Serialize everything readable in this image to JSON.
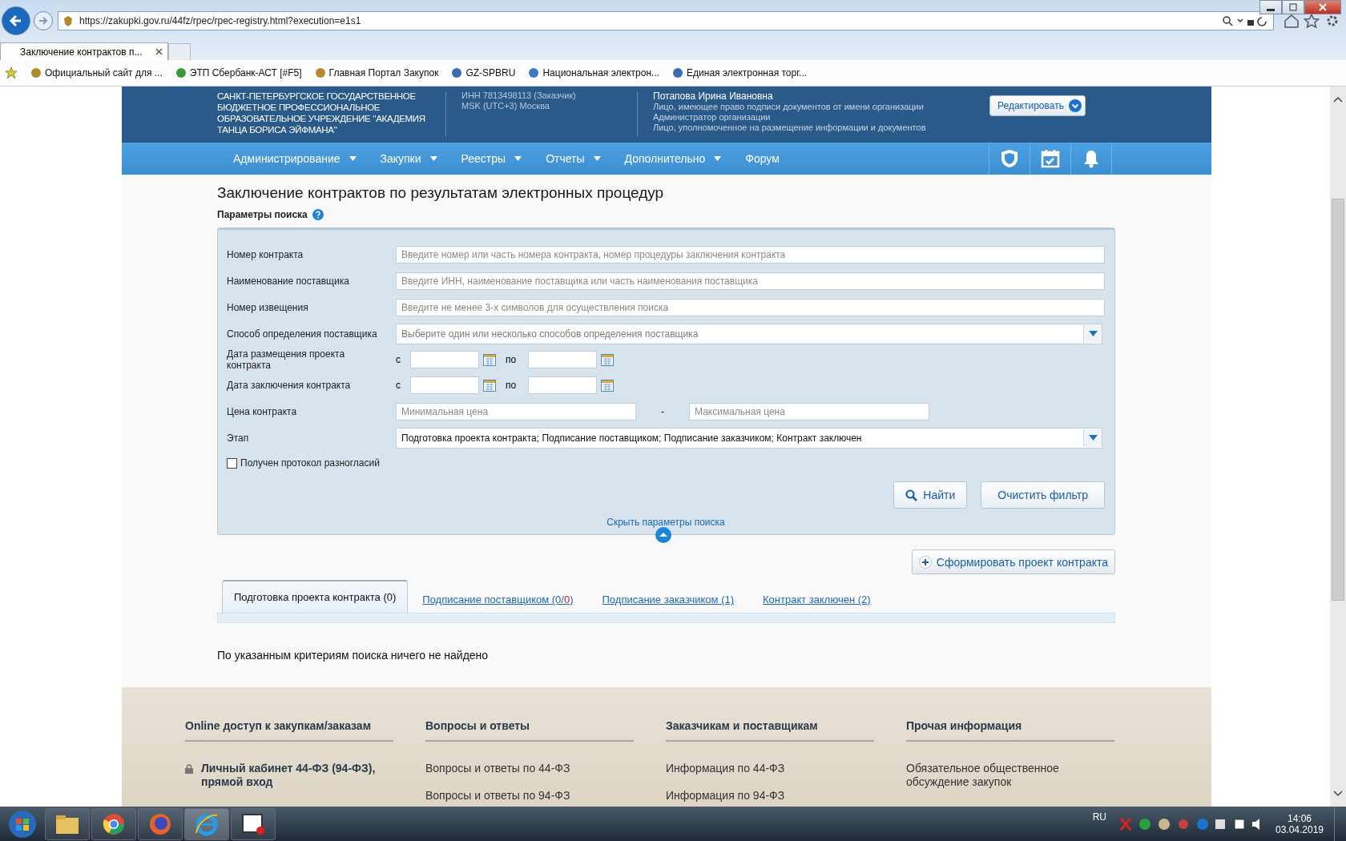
{
  "browser": {
    "url": "https://zakupki.gov.ru/44fz/rpec/rpec-registry.html?execution=e1s1",
    "tabs": [
      {
        "label": "Заключение контрактов п...",
        "selected": true
      }
    ],
    "favorites": [
      "Официальный сайт для ...",
      "ЭТП Сбербанк-АСТ [#F5]",
      "Главная Портал Закупок",
      "GZ-SPBRU",
      "Национальная электрон...",
      "Единая электронная торг..."
    ]
  },
  "header": {
    "org_name": "САНКТ-ПЕТЕРБУРГСКОЕ ГОСУДАРСТВЕННОЕ БЮДЖЕТНОЕ ПРОФЕССИОНАЛЬНОЕ ОБРАЗОВАТЕЛЬНОЕ УЧРЕЖДЕНИЕ \"АКАДЕМИЯ ТАНЦА БОРИСА ЭЙФМАНА\"",
    "inn": "ИНН 7813498113 (Заказчик)",
    "timezone": "MSK (UTC+3) Москва",
    "user_name": "Потапова Ирина Ивановна",
    "user_roles": [
      "Лицо, имеющее право подписи документов от имени организации",
      "Администратор организации",
      "Лицо, уполномоченное на размещение информации и документов"
    ],
    "edit_button": "Редактировать"
  },
  "nav": [
    {
      "label": "Администрирование",
      "dropdown": true
    },
    {
      "label": "Закупки",
      "dropdown": true
    },
    {
      "label": "Реестры",
      "dropdown": true
    },
    {
      "label": "Отчеты",
      "dropdown": true
    },
    {
      "label": "Дополнительно",
      "dropdown": true
    },
    {
      "label": "Форум",
      "dropdown": false
    }
  ],
  "title": "Заключение контрактов по результатам электронных процедур",
  "search_title": "Параметры поиска",
  "fields": [
    {
      "kind": "text",
      "label": "Номер контракта",
      "placeholder": "Введите номер или часть номера контракта, номер процедуры заключения контракта"
    },
    {
      "kind": "text",
      "label": "Наименование поставщика",
      "placeholder": "Введите ИНН, наименование поставщика или часть наименования поставщика"
    },
    {
      "kind": "text",
      "label": "Номер извещения",
      "placeholder": "Введите не менее 3-х символов для осуществления поиска"
    },
    {
      "kind": "select",
      "label": "Способ определения поставщика",
      "placeholder": "Выберите один или несколько способов определения поставщика"
    },
    {
      "kind": "daterange",
      "label": "Дата размещения проекта контракта",
      "from": "с",
      "to": "по"
    },
    {
      "kind": "daterange",
      "label": "Дата заключения контракта",
      "from": "с",
      "to": "по"
    },
    {
      "kind": "range",
      "label": "Цена контракта",
      "placeholder_min": "Минимальная цена",
      "separator": "-",
      "placeholder_max": "Максимальная цена"
    },
    {
      "kind": "select",
      "label": "Этап",
      "value": "Подготовка проекта контракта; Подписание поставщиком; Подписание заказчиком; Контракт заключен"
    },
    {
      "kind": "checkbox",
      "label": "Получен протокол разногласий",
      "checked": false
    }
  ],
  "buttons": [
    "Найти",
    "Очистить фильтр"
  ],
  "hide_link": "Скрыть параметры поиска",
  "create_button": "Сформировать проект контракта",
  "tabs": [
    {
      "label": "Подготовка проекта контракта (0)",
      "selected": true
    },
    {
      "label": "Подписание поставщиком (0/",
      "alert": "0",
      "tail": ")",
      "selected": false
    },
    {
      "label": "Подписание заказчиком (1)",
      "selected": false
    },
    {
      "label": "Контракт заключен (2)",
      "selected": false
    }
  ],
  "empty_message": "По указанным критериям поиска ничего не найдено",
  "footer": [
    {
      "heading": "Online доступ к закупкам/заказам",
      "links": [
        {
          "text": "Личный кабинет 44-ФЗ (94-ФЗ), прямой вход",
          "kind": "login"
        }
      ]
    },
    {
      "heading": "Вопросы и ответы",
      "links": [
        {
          "text": "Вопросы и ответы по 44-ФЗ",
          "kind": "link"
        },
        {
          "text": "Вопросы и ответы по 94-ФЗ",
          "kind": "link"
        }
      ]
    },
    {
      "heading": "Заказчикам и поставщикам",
      "links": [
        {
          "text": "Информация по 44-ФЗ",
          "kind": "link"
        },
        {
          "text": "Информация по 94-ФЗ",
          "kind": "link"
        }
      ]
    },
    {
      "heading": "Прочая информация",
      "links": [
        {
          "text": "Обязательное общественное обсуждение закупок",
          "kind": "link"
        }
      ]
    }
  ],
  "taskbar": {
    "language": "RU",
    "time": "14:06",
    "date": "03.04.2019"
  }
}
